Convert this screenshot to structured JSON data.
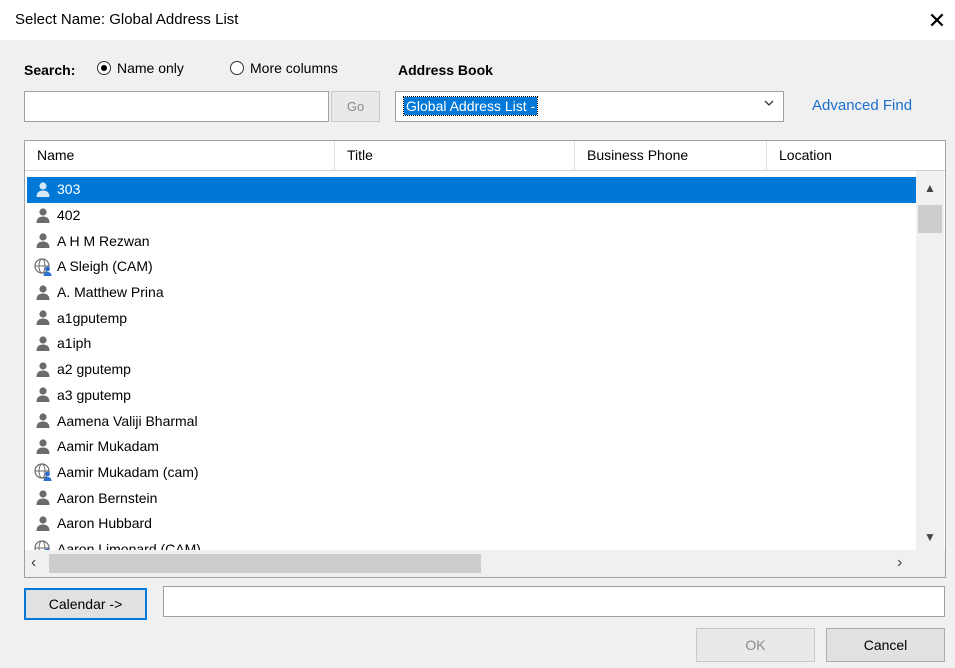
{
  "window": {
    "title": "Select Name: Global Address List",
    "close_glyph": "✕"
  },
  "search": {
    "label": "Search:",
    "options": [
      {
        "label": "Name only",
        "selected": true
      },
      {
        "label": "More columns",
        "selected": false
      }
    ],
    "input_value": "",
    "go_label": "Go"
  },
  "address_book": {
    "label": "Address Book",
    "selected": "Global Address List -",
    "advanced_find_label": "Advanced Find"
  },
  "table": {
    "columns": [
      "Name",
      "Title",
      "Business Phone",
      "Location"
    ],
    "rows": [
      {
        "name": "303",
        "icon": "user-icon",
        "selected": true
      },
      {
        "name": "402",
        "icon": "user-icon",
        "selected": false
      },
      {
        "name": "A H M Rezwan",
        "icon": "user-icon",
        "selected": false
      },
      {
        "name": "A Sleigh (CAM)",
        "icon": "external-contact-icon",
        "selected": false
      },
      {
        "name": "A. Matthew Prina",
        "icon": "user-icon",
        "selected": false
      },
      {
        "name": "a1gputemp",
        "icon": "user-icon",
        "selected": false
      },
      {
        "name": "a1iph",
        "icon": "user-icon",
        "selected": false
      },
      {
        "name": "a2 gputemp",
        "icon": "user-icon",
        "selected": false
      },
      {
        "name": "a3 gputemp",
        "icon": "user-icon",
        "selected": false
      },
      {
        "name": "Aamena Valiji Bharmal",
        "icon": "user-icon",
        "selected": false
      },
      {
        "name": "Aamir Mukadam",
        "icon": "user-icon",
        "selected": false
      },
      {
        "name": "Aamir Mukadam (cam)",
        "icon": "external-contact-icon",
        "selected": false
      },
      {
        "name": "Aaron Bernstein",
        "icon": "user-icon",
        "selected": false
      },
      {
        "name": "Aaron Hubbard",
        "icon": "user-icon",
        "selected": false
      },
      {
        "name": "Aaron Limonard (CAM)",
        "icon": "external-contact-icon",
        "selected": false
      }
    ]
  },
  "calendar": {
    "button_label": "Calendar ->",
    "input_value": ""
  },
  "footer": {
    "ok_label": "OK",
    "cancel_label": "Cancel"
  },
  "colors": {
    "selection": "#0078d7",
    "link": "#1a6fcf"
  }
}
